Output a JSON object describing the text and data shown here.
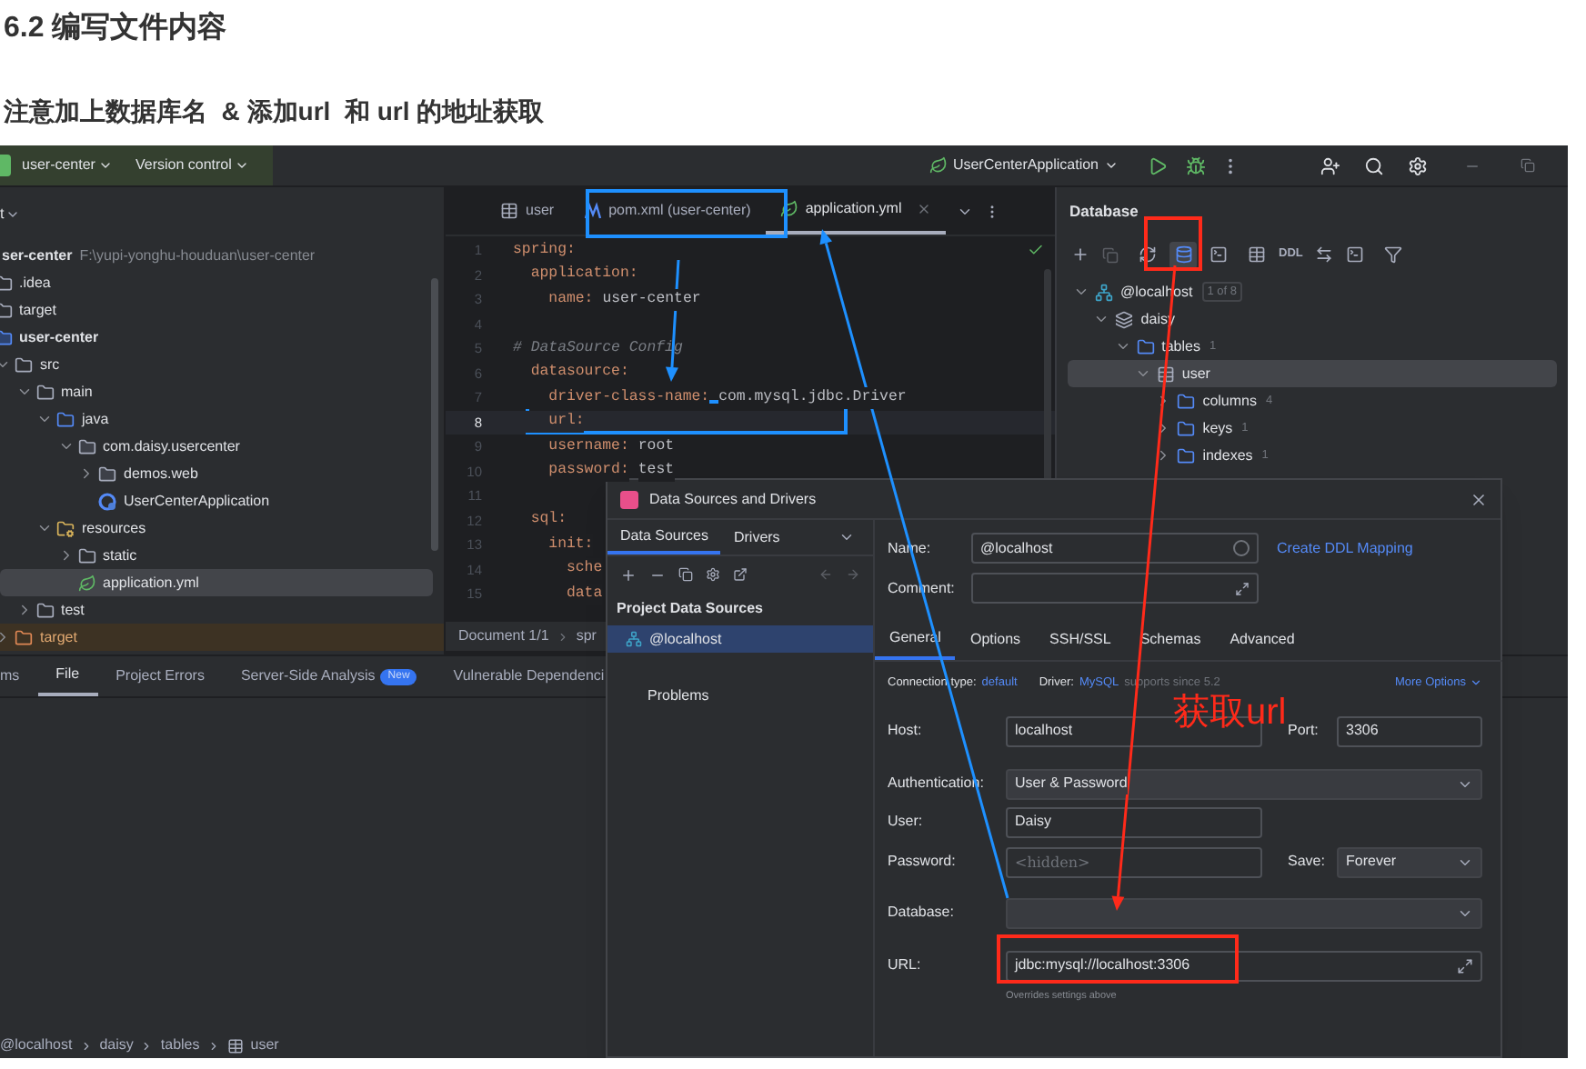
{
  "heading": "6.2 编写文件内容",
  "note": "注意加上数据库名  & 添加url  和 url 的地址获取",
  "ide": {
    "toolbar": {
      "project": "user-center",
      "vcs": "Version control",
      "run_config": "UserCenterApplication"
    },
    "project": {
      "header": "t",
      "items": [
        {
          "label": "ser-center",
          "kind": "root",
          "path": "F:\\yupi-yonghu-houduan\\user-center",
          "children": [
            {
              "label": ".idea",
              "kind": "folder"
            },
            {
              "label": "target",
              "kind": "folder"
            },
            {
              "label": "user-center",
              "kind": "module",
              "children": [
                {
                  "label": "src",
                  "kind": "folder",
                  "expanded": true,
                  "children": [
                    {
                      "label": "main",
                      "kind": "folder",
                      "expanded": true,
                      "children": [
                        {
                          "label": "java",
                          "kind": "source",
                          "expanded": true,
                          "children": [
                            {
                              "label": "com.daisy.usercenter",
                              "kind": "package",
                              "expanded": true,
                              "children": [
                                {
                                  "label": "demos.web",
                                  "kind": "package",
                                  "expanded": false
                                },
                                {
                                  "label": "UserCenterApplication",
                                  "kind": "class"
                                }
                              ]
                            }
                          ]
                        },
                        {
                          "label": "resources",
                          "kind": "resources",
                          "expanded": true,
                          "children": [
                            {
                              "label": "static",
                              "kind": "folder",
                              "expanded": false
                            },
                            {
                              "label": "application.yml",
                              "kind": "yml",
                              "selected": true
                            }
                          ]
                        }
                      ]
                    },
                    {
                      "label": "test",
                      "kind": "folder",
                      "expanded": false
                    }
                  ]
                },
                {
                  "label": "target",
                  "kind": "excluded",
                  "expanded": false
                }
              ]
            }
          ]
        }
      ]
    },
    "editor": {
      "tabs": [
        {
          "label": "user",
          "kind": "table",
          "selected": false
        },
        {
          "label": "pom.xml (user-center)",
          "kind": "maven",
          "selected": false
        },
        {
          "label": "application.yml",
          "kind": "yml",
          "selected": true
        }
      ],
      "lines": [
        {
          "number": "1",
          "key": "spring:",
          "current": false
        },
        {
          "number": "2",
          "key": "  application:",
          "current": false
        },
        {
          "number": "3",
          "key": "    name:",
          "value": "user-center",
          "current": false
        },
        {
          "number": "4",
          "current": false
        },
        {
          "number": "5",
          "comment": "# DataSource Config",
          "current": false
        },
        {
          "number": "6",
          "key": "  datasource:",
          "current": false
        },
        {
          "number": "7",
          "key": "    driver-class-name:",
          "value": "com.mysql.jdbc.Driver",
          "current": false
        },
        {
          "number": "8",
          "key": "    url:",
          "current": true
        },
        {
          "number": "9",
          "key": "    username:",
          "value": "root",
          "current": false
        },
        {
          "number": "10",
          "key": "    password:",
          "value": "test",
          "current": false
        },
        {
          "number": "11",
          "current": false
        },
        {
          "number": "12",
          "key": "  sql:",
          "current": false
        },
        {
          "number": "13",
          "key": "    init:",
          "current": false
        },
        {
          "number": "14",
          "key": "      sche",
          "current": false
        },
        {
          "number": "15",
          "key": "      data",
          "current": false
        }
      ],
      "status": [
        "Document 1/1",
        "spr"
      ]
    },
    "database": {
      "title": "Database",
      "ddl": "DDL",
      "tree": [
        {
          "label": "@localhost",
          "kind": "host",
          "count": "1 of 8",
          "expanded": true,
          "children": [
            {
              "label": "daisy",
              "kind": "schema",
              "expanded": true,
              "children": [
                {
                  "label": "tables",
                  "kind": "folder",
                  "count": "1",
                  "expanded": true,
                  "children": [
                    {
                      "label": "user",
                      "kind": "table",
                      "expanded": true,
                      "selected": true,
                      "children": [
                        {
                          "label": "columns",
                          "kind": "folder",
                          "count": "4",
                          "expanded": false
                        },
                        {
                          "label": "keys",
                          "kind": "folder",
                          "count": "1",
                          "expanded": false
                        },
                        {
                          "label": "indexes",
                          "kind": "folder",
                          "count": "1",
                          "expanded": false
                        }
                      ]
                    }
                  ]
                }
              ]
            }
          ]
        }
      ]
    },
    "bottom": {
      "tabs": [
        {
          "label": "ms",
          "selected": false
        },
        {
          "label": "File",
          "selected": true
        },
        {
          "label": "Project Errors",
          "selected": false
        },
        {
          "label": "Server-Side Analysis",
          "badge": "New",
          "selected": false
        },
        {
          "label": "Vulnerable Dependenci",
          "selected": false
        }
      ],
      "breadcrumb": [
        "@localhost",
        "daisy",
        "tables",
        "user"
      ]
    },
    "dialog": {
      "title": "Data Sources and Drivers",
      "side_tabs": [
        {
          "label": "Data Sources",
          "selected": true
        },
        {
          "label": "Drivers",
          "selected": false
        }
      ],
      "section": "Project Data Sources",
      "sources": [
        {
          "label": "@localhost",
          "selected": true
        }
      ],
      "problems": "Problems",
      "name": {
        "label": "Name:",
        "value": "@localhost"
      },
      "ddl_link": "Create DDL Mapping",
      "comment": {
        "label": "Comment:"
      },
      "tabs": [
        {
          "label": "General",
          "selected": true
        },
        {
          "label": "Options",
          "selected": false
        },
        {
          "label": "SSH/SSL",
          "selected": false
        },
        {
          "label": "Schemas",
          "selected": false
        },
        {
          "label": "Advanced",
          "selected": false
        }
      ],
      "connection": {
        "type_label": "Connection type:",
        "type": "default",
        "driver_label": "Driver:",
        "driver": "MySQL",
        "driver_note": "supports since 5.2",
        "more": "More Options"
      },
      "rows": [
        {
          "fields": [
            {
              "label": "Host:",
              "value": "localhost",
              "kind": "text"
            },
            {
              "label": "Port:",
              "value": "3306",
              "kind": "text"
            }
          ]
        },
        {
          "fields": [
            {
              "label": "Authentication:",
              "value": "User & Password",
              "kind": "dropdown"
            }
          ]
        },
        {
          "fields": [
            {
              "label": "User:",
              "value": "Daisy",
              "kind": "text"
            }
          ]
        },
        {
          "fields": [
            {
              "label": "Password:",
              "placeholder": "<hidden>",
              "kind": "text"
            },
            {
              "label": "Save:",
              "value": "Forever",
              "kind": "dropdown"
            }
          ]
        },
        {
          "fields": [
            {
              "label": "Database:",
              "kind": "dropdown"
            }
          ]
        },
        {
          "fields": [
            {
              "label": "URL:",
              "value": "jdbc:mysql://localhost:3306",
              "kind": "expandable",
              "hint": "Overrides settings above"
            }
          ]
        }
      ]
    }
  },
  "annotation": {
    "label": "获取url"
  }
}
